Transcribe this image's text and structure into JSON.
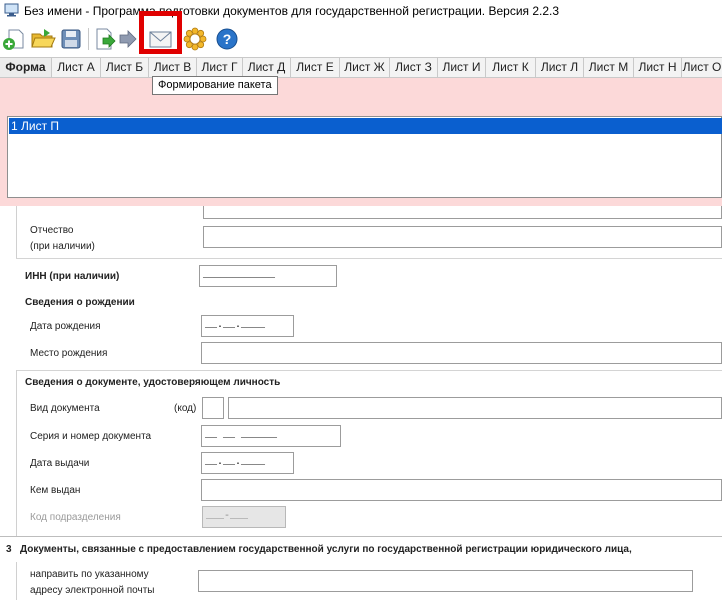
{
  "window": {
    "title": "Без имени - Программа подготовки документов для государственной регистрации. Версия 2.2.3"
  },
  "toolbar": {
    "buttons": [
      "new-document-icon",
      "open-folder-icon",
      "save-disk-icon",
      "export-arrow-icon",
      "import-arrow-icon",
      "envelope-icon",
      "settings-gear-icon",
      "help-icon"
    ],
    "highlighted": "envelope-icon",
    "tooltip": "Формирование пакета"
  },
  "tabs": {
    "items": [
      "Форма",
      "Лист А",
      "Лист Б",
      "Лист В",
      "Лист Г",
      "Лист Д",
      "Лист Е",
      "Лист Ж",
      "Лист З",
      "Лист И",
      "Лист К",
      "Лист Л",
      "Лист М",
      "Лист Н",
      "Лист О"
    ],
    "active": "Форма"
  },
  "sheet_list": {
    "items": [
      "1 Лист П"
    ],
    "selected": "1 Лист П"
  },
  "form": {
    "patronymic_label_1": "Отчество",
    "patronymic_label_2": "(при наличии)",
    "inn_label": "ИНН (при наличии)",
    "inn_value": "____________",
    "birth_section": "Сведения о рождении",
    "birth_date_label": "Дата рождения",
    "birth_date_value": "__.__.____",
    "birth_place_label": "Место рождения",
    "id_section": "Сведения о документе, удостоверяющем личность",
    "doc_type_label": "Вид документа",
    "doc_code_label": "(код)",
    "doc_number_label": "Серия и номер документа",
    "doc_number_value": "__ __ ______",
    "issue_date_label": "Дата выдачи",
    "issue_date_value": "__.__.____",
    "issued_by_label": "Кем выдан",
    "division_code_label": "Код подразделения",
    "division_code_value": "___-___",
    "section3_number": "3",
    "section3_title": "Документы, связанные с предоставлением государственной услуги по государственной регистрации юридического лица,",
    "email_label_1": "направить по указанному",
    "email_label_2": "адресу электронной почты"
  },
  "colors": {
    "accent_red": "#e00000",
    "selection_blue": "#0a5fcf",
    "pink_panel": "#fcd9d9"
  }
}
